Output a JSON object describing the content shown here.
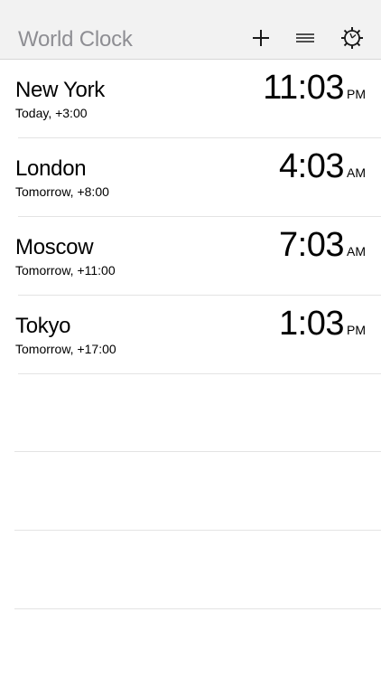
{
  "header": {
    "title": "World Clock",
    "add_icon": "plus-icon",
    "menu_icon": "reorder-icon",
    "settings_icon": "gear-icon"
  },
  "clocks": [
    {
      "city": "New York",
      "offset": "Today, +3:00",
      "time": "11:03",
      "ampm": "PM"
    },
    {
      "city": "London",
      "offset": "Tomorrow, +8:00",
      "time": "4:03",
      "ampm": "AM"
    },
    {
      "city": "Moscow",
      "offset": "Tomorrow, +11:00",
      "time": "7:03",
      "ampm": "AM"
    },
    {
      "city": "Tokyo",
      "offset": "Tomorrow, +17:00",
      "time": "1:03",
      "ampm": "PM"
    }
  ]
}
